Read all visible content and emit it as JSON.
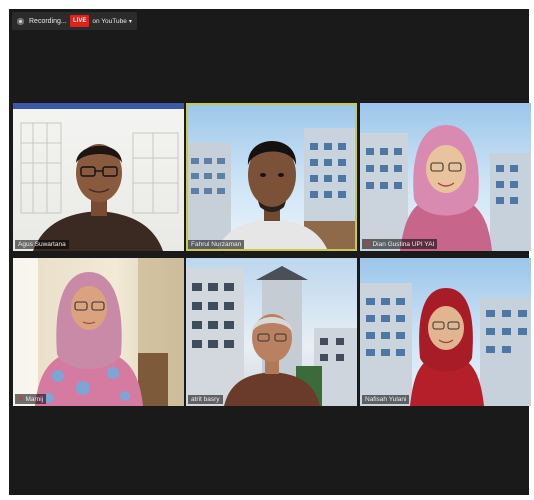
{
  "toolbar": {
    "recording_label": "Recording...",
    "live_badge": "LIVE",
    "live_label": "on YouTube",
    "caret": "▾"
  },
  "participants": [
    {
      "name": "Agus Suwartana",
      "muted": false,
      "active": false
    },
    {
      "name": "Fahrul Nurzaman",
      "muted": false,
      "active": true
    },
    {
      "name": "Dian Gustina UPI YAI",
      "muted": true,
      "active": false
    },
    {
      "name": "Marnij",
      "muted": true,
      "active": false
    },
    {
      "name": "atrit basry",
      "muted": false,
      "active": false
    },
    {
      "name": "Nafisah Yulani",
      "muted": false,
      "active": false
    }
  ],
  "colors": {
    "stage": "#1a1a1a",
    "active_speaker_border": "#c9c94a",
    "live_red": "#e0201b"
  }
}
